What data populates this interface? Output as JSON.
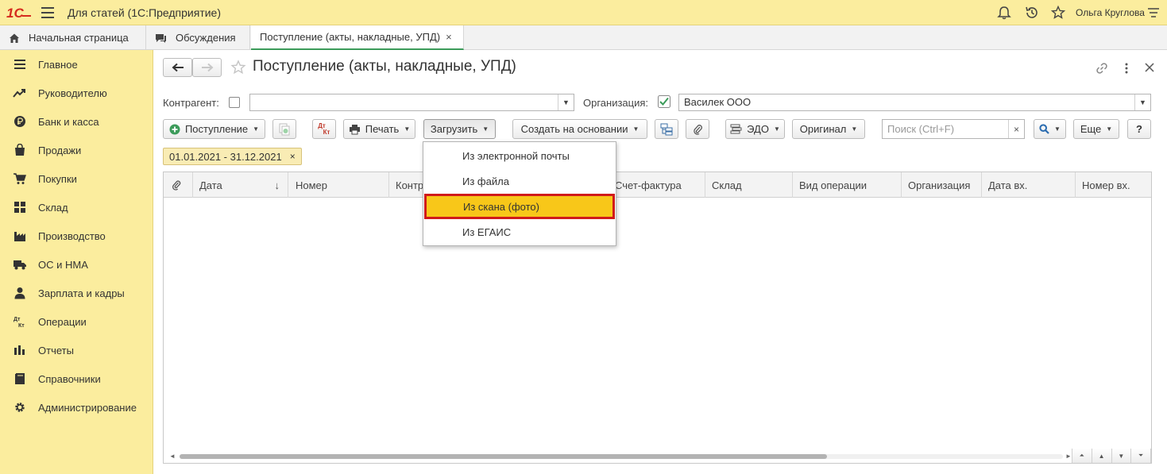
{
  "app": {
    "title": "Для статей  (1С:Предприятие)",
    "user": "Ольга Круглова",
    "logo_text": "1С"
  },
  "tabs": [
    {
      "label": "Начальная страница"
    },
    {
      "label": "Обсуждения"
    },
    {
      "label": "Поступление (акты, накладные, УПД)",
      "close": "×"
    }
  ],
  "sidebar": {
    "items": [
      {
        "label": "Главное"
      },
      {
        "label": "Руководителю"
      },
      {
        "label": "Банк и касса"
      },
      {
        "label": "Продажи"
      },
      {
        "label": "Покупки"
      },
      {
        "label": "Склад"
      },
      {
        "label": "Производство"
      },
      {
        "label": "ОС и НМА"
      },
      {
        "label": "Зарплата и кадры"
      },
      {
        "label": "Операции"
      },
      {
        "label": "Отчеты"
      },
      {
        "label": "Справочники"
      },
      {
        "label": "Администрирование"
      }
    ]
  },
  "document": {
    "title": "Поступление (акты, накладные, УПД)"
  },
  "filters": {
    "counterparty_label": "Контрагент:",
    "counterparty_value": "",
    "organization_label": "Организация:",
    "organization_value": "Василек ООО"
  },
  "toolbar": {
    "receipt": "Поступление",
    "dt_kt_top": "Дт",
    "dt_kt_bottom": "Кт",
    "print": "Печать",
    "load": "Загрузить",
    "create_based": "Создать на основании",
    "edo": "ЭДО",
    "original": "Оригинал",
    "search_placeholder": "Поиск (Ctrl+F)",
    "search_clear": "×",
    "more": "Еще",
    "help": "?"
  },
  "period": {
    "label": "01.01.2021 - 31.12.2021",
    "close": "×"
  },
  "table": {
    "columns": [
      "Дата",
      "Номер",
      "Контр",
      "Счет-фактура",
      "Склад",
      "Вид операции",
      "Организация",
      "Дата вх.",
      "Номер вх."
    ],
    "sort_indicator": "↓"
  },
  "load_menu": {
    "items": [
      {
        "label": "Из электронной почты"
      },
      {
        "label": "Из файла"
      },
      {
        "label": "Из скана (фото)",
        "highlighted": true
      },
      {
        "label": "Из ЕГАИС"
      }
    ]
  },
  "colors": {
    "header_bg": "#fbed9e",
    "accent_green": "#3c9b5a",
    "highlight_bg": "#f8c719",
    "highlight_border": "#d01a1a",
    "logo_red": "#d52b1e"
  }
}
